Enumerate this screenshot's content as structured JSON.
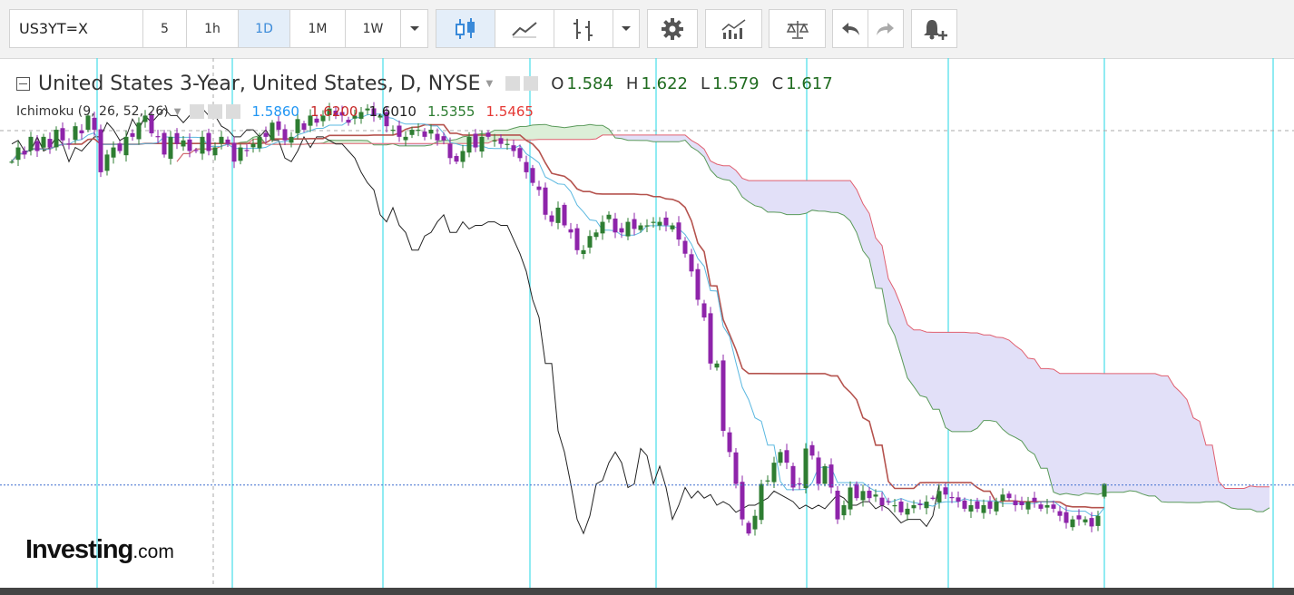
{
  "toolbar": {
    "symbol": "US3YT=X",
    "intervals": [
      {
        "label": "5",
        "active": false
      },
      {
        "label": "1h",
        "active": false
      },
      {
        "label": "1D",
        "active": true
      },
      {
        "label": "1M",
        "active": false
      },
      {
        "label": "1W",
        "active": false
      }
    ],
    "icons": [
      "chevron-down-icon",
      "candlestick-icon",
      "line-chart-icon",
      "bar-chart-icon",
      "chevron-down-icon",
      "gear-icon",
      "indicators-icon",
      "compare-icon",
      "undo-icon",
      "redo-icon",
      "alert-add-icon"
    ]
  },
  "legend": {
    "title": "United States 3-Year, United States, D, NYSE",
    "ohlc": [
      {
        "key": "O",
        "value": "1.584"
      },
      {
        "key": "H",
        "value": "1.622"
      },
      {
        "key": "L",
        "value": "1.579"
      },
      {
        "key": "C",
        "value": "1.617"
      }
    ],
    "indicator": "Ichimoku (9, 26, 52, 26)",
    "indicator_values": [
      {
        "value": "1.5860",
        "color": "#2196f3"
      },
      {
        "value": "1.6200",
        "color": "#c62828"
      },
      {
        "value": "1.6010",
        "color": "#222222"
      },
      {
        "value": "1.5355",
        "color": "#2e7d32"
      },
      {
        "value": "1.5465",
        "color": "#e53935"
      }
    ]
  },
  "watermark": {
    "brand": "Investing",
    "suffix": ".com"
  },
  "colors": {
    "up": "#2e7d32",
    "down": "#8e24aa",
    "tenkan": "#5bb8e0",
    "kijun": "#b5534e",
    "chikou": "#222222",
    "cloud_bear": "#e2e0f8",
    "cloud_bull": "#dcefd8",
    "span_a": "#5a9a5a",
    "span_b": "#e06070",
    "vgrid": "#55e0ea",
    "price_line": "#3f6fd0"
  },
  "chart_data": {
    "type": "candlestick",
    "instrument": "US3YT=X",
    "interval": "D",
    "ylim": [
      1.35,
      2.72
    ],
    "last_price": 1.617,
    "closes": [
      2.53,
      2.57,
      2.55,
      2.6,
      2.56,
      2.6,
      2.57,
      2.62,
      2.59,
      2.58,
      2.63,
      2.61,
      2.66,
      2.62,
      2.5,
      2.55,
      2.57,
      2.56,
      2.6,
      2.6,
      2.64,
      2.66,
      2.61,
      2.6,
      2.55,
      2.6,
      2.58,
      2.59,
      2.56,
      2.56,
      2.6,
      2.56,
      2.57,
      2.6,
      2.58,
      2.53,
      2.57,
      2.56,
      2.58,
      2.6,
      2.6,
      2.64,
      2.62,
      2.59,
      2.6,
      2.65,
      2.62,
      2.66,
      2.64,
      2.66,
      2.68,
      2.66,
      2.66,
      2.64,
      2.66,
      2.67,
      2.68,
      2.66,
      2.66,
      2.63,
      2.62,
      2.6,
      2.6,
      2.62,
      2.62,
      2.6,
      2.62,
      2.59,
      2.59,
      2.54,
      2.53,
      2.56,
      2.6,
      2.57,
      2.6,
      2.6,
      2.59,
      2.58,
      2.58,
      2.56,
      2.54,
      2.5,
      2.47,
      2.45,
      2.38,
      2.36,
      2.4,
      2.35,
      2.33,
      2.28,
      2.28,
      2.32,
      2.33,
      2.36,
      2.38,
      2.33,
      2.33,
      2.36,
      2.34,
      2.35,
      2.35,
      2.36,
      2.36,
      2.35,
      2.35,
      2.31,
      2.27,
      2.22,
      2.14,
      2.09,
      1.96,
      1.96,
      1.77,
      1.71,
      1.62,
      1.52,
      1.48,
      1.53,
      1.62,
      1.63,
      1.68,
      1.71,
      1.68,
      1.61,
      1.62,
      1.72,
      1.7,
      1.62,
      1.67,
      1.61,
      1.52,
      1.56,
      1.61,
      1.58,
      1.6,
      1.58,
      1.59,
      1.56,
      1.57,
      1.56,
      1.54,
      1.55,
      1.56,
      1.56,
      1.57,
      1.58,
      1.6,
      1.59,
      1.58,
      1.57,
      1.55,
      1.56,
      1.55,
      1.56,
      1.55,
      1.57,
      1.59,
      1.58,
      1.56,
      1.56,
      1.57,
      1.57,
      1.55,
      1.56,
      1.55,
      1.53,
      1.51,
      1.52,
      1.52,
      1.52,
      1.5,
      1.53,
      1.62
    ]
  }
}
